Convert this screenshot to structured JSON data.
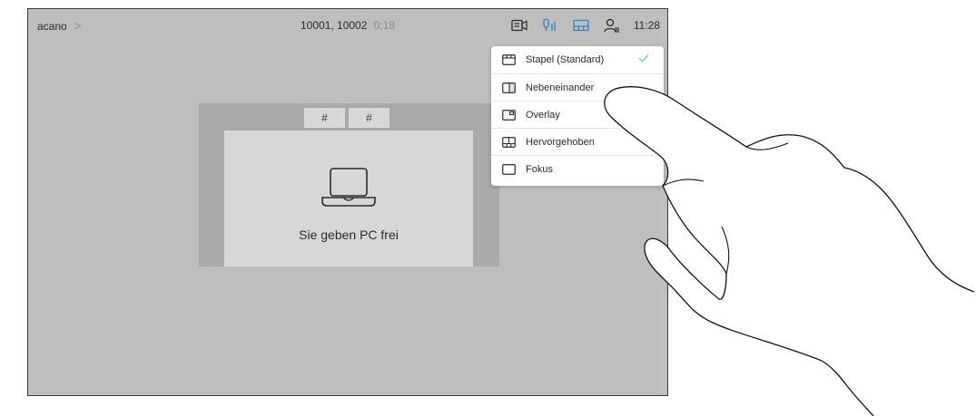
{
  "topbar": {
    "breadcrumb": "acano",
    "call_participants": "10001, 10002",
    "call_duration": "0:18",
    "clock": "11:28",
    "icons": [
      "selfview-icon",
      "microphone-icon",
      "layout-icon",
      "participants-icon"
    ]
  },
  "stage": {
    "tiles": [
      "#",
      "#"
    ],
    "share_message": "Sie geben PC frei"
  },
  "layout_menu": {
    "items": [
      {
        "label": "Stapel (Standard)",
        "icon": "stack-layout-icon",
        "selected": true
      },
      {
        "label": "Nebeneinander",
        "icon": "side-by-side-layout-icon",
        "selected": false
      },
      {
        "label": "Overlay",
        "icon": "overlay-layout-icon",
        "selected": false
      },
      {
        "label": "Hervorgehoben",
        "icon": "prominent-layout-icon",
        "selected": false
      },
      {
        "label": "Fokus",
        "icon": "focus-layout-icon",
        "selected": false
      }
    ]
  },
  "colors": {
    "screen_bg": "#bebebe",
    "stage_bg": "#a9a9a9",
    "tile_bg": "#d7d7d7",
    "accent": "#1e88c7",
    "check": "#64b5dc"
  }
}
